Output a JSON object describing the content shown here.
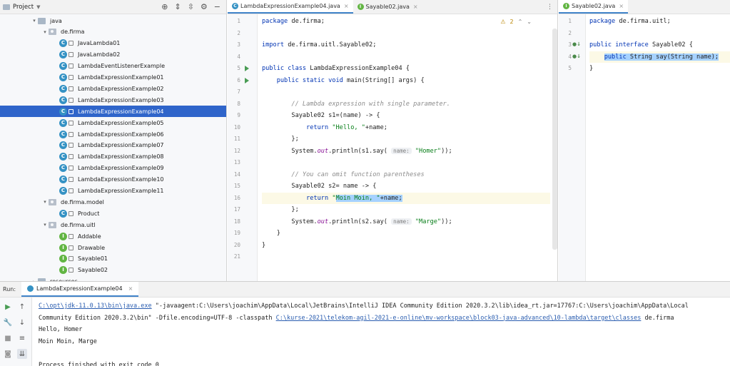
{
  "project": {
    "title": "Project",
    "tree": [
      {
        "label": "java",
        "kind": "folder",
        "indent": 3,
        "expanded": true
      },
      {
        "label": "de.firma",
        "kind": "pkg",
        "indent": 4,
        "expanded": true
      },
      {
        "label": "JavaLambda01",
        "kind": "class",
        "indent": 5
      },
      {
        "label": "JavaLambda02",
        "kind": "class",
        "indent": 5
      },
      {
        "label": "LambdaEventListenerExample",
        "kind": "class",
        "indent": 5
      },
      {
        "label": "LambdaExpressionExample01",
        "kind": "class",
        "indent": 5
      },
      {
        "label": "LambdaExpressionExample02",
        "kind": "class",
        "indent": 5
      },
      {
        "label": "LambdaExpressionExample03",
        "kind": "class",
        "indent": 5
      },
      {
        "label": "LambdaExpressionExample04",
        "kind": "class",
        "indent": 5,
        "selected": true
      },
      {
        "label": "LambdaExpressionExample05",
        "kind": "class",
        "indent": 5
      },
      {
        "label": "LambdaExpressionExample06",
        "kind": "class",
        "indent": 5
      },
      {
        "label": "LambdaExpressionExample07",
        "kind": "class",
        "indent": 5
      },
      {
        "label": "LambdaExpressionExample08",
        "kind": "class",
        "indent": 5
      },
      {
        "label": "LambdaExpressionExample09",
        "kind": "class",
        "indent": 5
      },
      {
        "label": "LambdaExpressionExample10",
        "kind": "class",
        "indent": 5
      },
      {
        "label": "LambdaExpressionExample11",
        "kind": "class",
        "indent": 5
      },
      {
        "label": "de.firma.model",
        "kind": "pkg",
        "indent": 4,
        "expanded": true
      },
      {
        "label": "Product",
        "kind": "class",
        "indent": 5
      },
      {
        "label": "de.firma.uitl",
        "kind": "pkg",
        "indent": 4,
        "expanded": true
      },
      {
        "label": "Addable",
        "kind": "interface",
        "indent": 5
      },
      {
        "label": "Drawable",
        "kind": "interface",
        "indent": 5
      },
      {
        "label": "Sayable01",
        "kind": "interface",
        "indent": 5
      },
      {
        "label": "Sayable02",
        "kind": "interface",
        "indent": 5
      },
      {
        "label": "resources",
        "kind": "folder",
        "indent": 3,
        "expanded": false
      }
    ]
  },
  "editor1": {
    "tabs": [
      {
        "label": "LambdaExpressionExample04.java",
        "active": true,
        "kind": "class"
      },
      {
        "label": "Sayable02.java",
        "active": false,
        "kind": "interface"
      }
    ],
    "warnings": "2",
    "lines": [
      {
        "n": "1",
        "html": "<span class='kw'>package</span> de.firma;"
      },
      {
        "n": "2",
        "html": ""
      },
      {
        "n": "3",
        "html": "<span class='kw'>import</span> de.firma.uitl.Sayable02;"
      },
      {
        "n": "4",
        "html": ""
      },
      {
        "n": "5",
        "html": "<span class='kw'>public class</span> LambdaExpressionExample04 {",
        "run": true
      },
      {
        "n": "6",
        "html": "    <span class='kw'>public static void</span> main(String[] args) {",
        "run": true
      },
      {
        "n": "7",
        "html": ""
      },
      {
        "n": "8",
        "html": "        <span class='cmt'>// Lambda expression with single parameter.</span>"
      },
      {
        "n": "9",
        "html": "        Sayable02 s1=(name) -> {"
      },
      {
        "n": "10",
        "html": "            <span class='kw'>return</span> <span class='str'>\"Hello, \"</span>+name;"
      },
      {
        "n": "11",
        "html": "        };"
      },
      {
        "n": "12",
        "html": "        System.<span class='fld'>out</span>.println(s1.say( <span class='hint'>name:</span> <span class='str'>\"Homer\"</span>));"
      },
      {
        "n": "13",
        "html": ""
      },
      {
        "n": "14",
        "html": "        <span class='cmt'>// You can omit function parentheses</span>"
      },
      {
        "n": "15",
        "html": "        Sayable02 s2= name -> {"
      },
      {
        "n": "16",
        "html": "            <span class='kw'>return</span> <span class='str'>\"<span class='sel'>Moin Moin, \"</span></span><span class='sel'>+name;</span>",
        "current": true
      },
      {
        "n": "17",
        "html": "        };"
      },
      {
        "n": "18",
        "html": "        System.<span class='fld'>out</span>.println(s2.say( <span class='hint'>name:</span> <span class='str'>\"Marge\"</span>));"
      },
      {
        "n": "19",
        "html": "    }"
      },
      {
        "n": "20",
        "html": "}"
      },
      {
        "n": "21",
        "html": ""
      }
    ]
  },
  "editor2": {
    "tabs": [
      {
        "label": "Sayable02.java",
        "active": true,
        "kind": "interface"
      }
    ],
    "lines": [
      {
        "n": "1",
        "html": "<span class='kw'>package</span> de.firma.uitl;"
      },
      {
        "n": "2",
        "html": ""
      },
      {
        "n": "3",
        "html": "<span class='kw'>public interface</span> Sayable02 {",
        "impl": true
      },
      {
        "n": "4",
        "html": "    <span class='sel'><span class='kw'>public</span> String say(String name);</span>",
        "impl": true,
        "current": true
      },
      {
        "n": "5",
        "html": "}"
      }
    ]
  },
  "run": {
    "label": "Run:",
    "tab": "LambdaExpressionExample04",
    "console": [
      {
        "parts": [
          {
            "t": "C:\\opt\\jdk-11.0.13\\bin\\java.exe",
            "link": true
          },
          {
            "t": " \"-javaagent:C:\\Users\\joachim\\AppData\\Local\\JetBrains\\IntelliJ IDEA Community Edition 2020.3.2\\lib\\idea_rt.jar=17767:C:\\Users\\joachim\\AppData\\Local"
          }
        ]
      },
      {
        "parts": [
          {
            "t": " Community Edition 2020.3.2\\bin\" -Dfile.encoding=UTF-8 -classpath "
          },
          {
            "t": "C:\\kurse-2021\\telekom-agil-2021-e-online\\mv-workspace\\block03-java-advanced\\10-lambda\\target\\classes",
            "link": true
          },
          {
            "t": " de.firma"
          }
        ]
      },
      {
        "parts": [
          {
            "t": "Hello, Homer"
          }
        ]
      },
      {
        "parts": [
          {
            "t": "Moin Moin, Marge"
          }
        ]
      },
      {
        "parts": [
          {
            "t": ""
          }
        ]
      },
      {
        "parts": [
          {
            "t": "Process finished with exit code 0"
          }
        ]
      }
    ]
  }
}
